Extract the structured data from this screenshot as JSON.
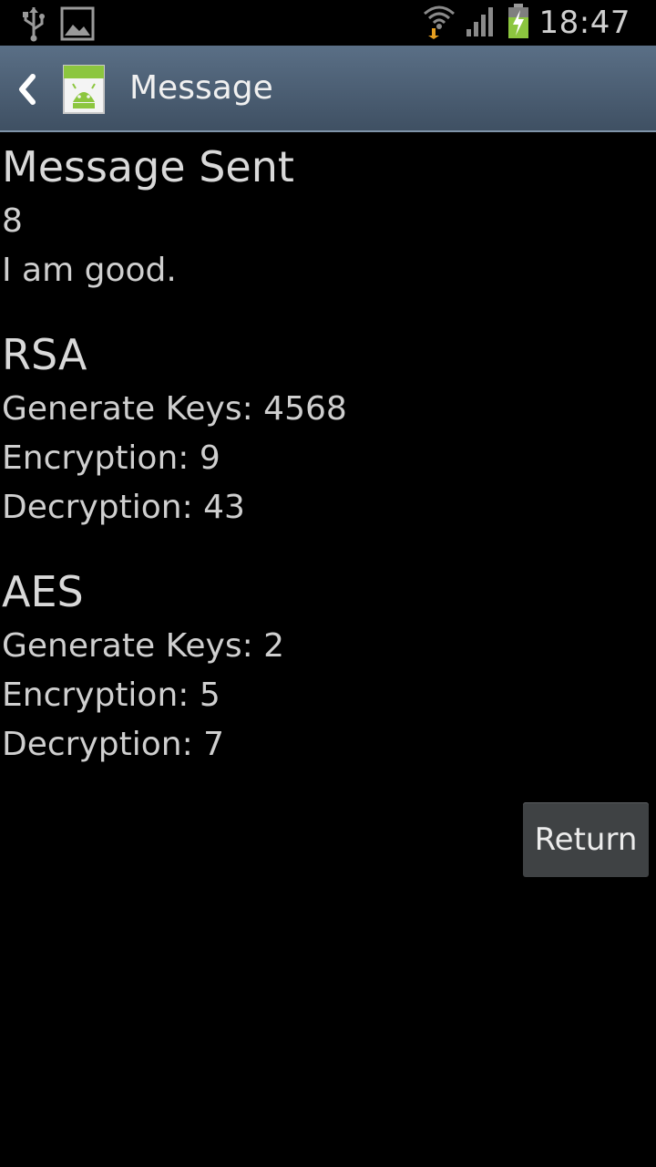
{
  "status_bar": {
    "time": "18:47",
    "icons": [
      "usb-icon",
      "image-icon",
      "wifi-icon",
      "signal-icon",
      "battery-charging-icon"
    ]
  },
  "action_bar": {
    "title": "Message",
    "app_icon_label": "Android"
  },
  "message": {
    "heading": "Message Sent",
    "number": "8",
    "text": "I am good."
  },
  "rsa": {
    "title": "RSA",
    "generate_keys": "Generate Keys: 4568",
    "encryption": "Encryption: 9",
    "decryption": "Decryption: 43"
  },
  "aes": {
    "title": "AES",
    "generate_keys": "Generate Keys: 2",
    "encryption": "Encryption: 5",
    "decryption": "Decryption: 7"
  },
  "buttons": {
    "return_label": "Return"
  },
  "colors": {
    "background": "#000000",
    "action_bar": "#4d6178",
    "text": "#d6d6d6",
    "button": "#3f4244"
  }
}
